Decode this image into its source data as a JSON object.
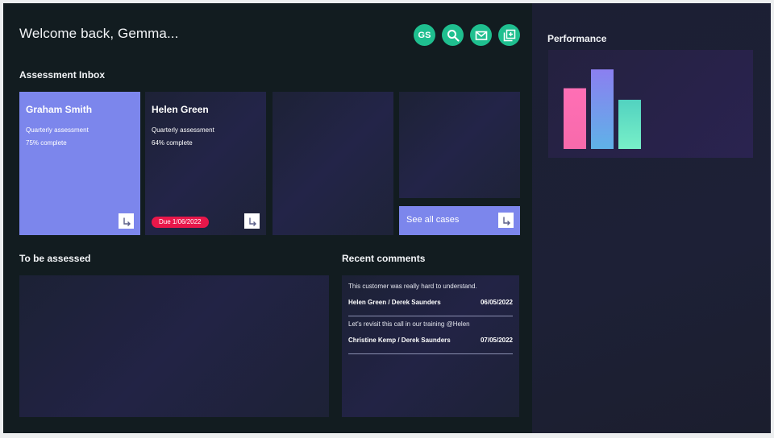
{
  "header": {
    "welcome": "Welcome back, Gemma..."
  },
  "toolbar": {
    "avatar_initials": "GS",
    "buttons": [
      {
        "icon": "search-icon"
      },
      {
        "icon": "mail-icon"
      },
      {
        "icon": "add-document-icon"
      }
    ]
  },
  "inbox": {
    "title": "Assessment Inbox",
    "cards": [
      {
        "name": "Graham Smith",
        "type": "Quarterly assessment",
        "progress": "75% complete"
      },
      {
        "name": "Helen Green",
        "type": "Quarterly assessment",
        "progress": "64% complete",
        "due": "Due 1/06/2022"
      }
    ],
    "see_all": "See all cases"
  },
  "to_be_assessed": {
    "title": "To be assessed"
  },
  "recent_comments": {
    "title": "Recent comments",
    "items": [
      {
        "text": "This customer was really hard to understand.",
        "people": "Helen Green / Derek Saunders",
        "date": "06/05/2022"
      },
      {
        "text": "Let's revisit this call in our training @Helen",
        "people": "Christine Kemp / Derek Saunders",
        "date": "07/05/2022"
      }
    ]
  },
  "performance": {
    "title": "Performance",
    "chart_data": {
      "type": "bar",
      "values": [
        58,
        76,
        47
      ],
      "ylim": [
        0,
        100
      ],
      "colors": [
        [
          "#ff6fb5",
          "#f76aab"
        ],
        [
          "#8b7ff0",
          "#5fb2e8"
        ],
        [
          "#52d2c0",
          "#78f0c8"
        ]
      ]
    }
  },
  "colors": {
    "accent": "#7c86ec",
    "icon_bg": "#1fbf8f",
    "due_badge": "#e8174a"
  }
}
